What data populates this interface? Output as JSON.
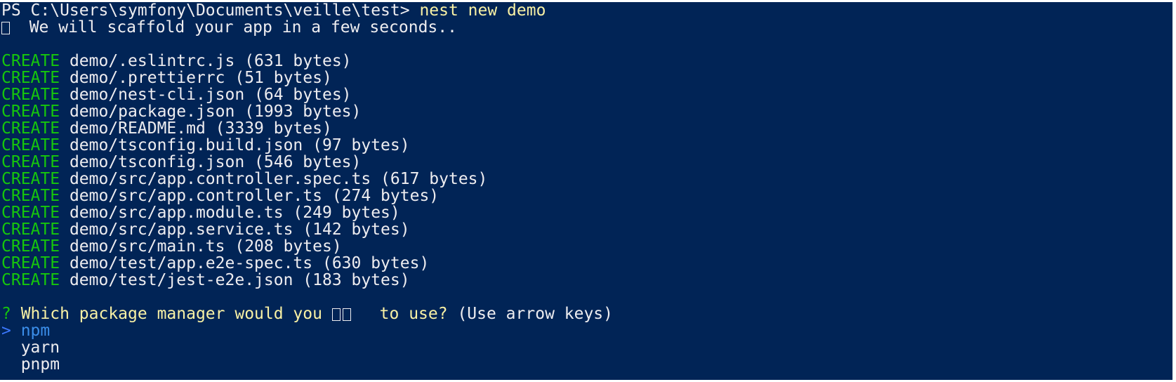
{
  "terminal": {
    "prompt": "PS C:\\Users\\symfony\\Documents\\veille\\test> ",
    "command": "nest new demo",
    "scaffold_message": "  We will scaffold your app in a few seconds..",
    "create_keyword": "CREATE",
    "files": [
      " demo/.eslintrc.js (631 bytes)",
      " demo/.prettierrc (51 bytes)",
      " demo/nest-cli.json (64 bytes)",
      " demo/package.json (1993 bytes)",
      " demo/README.md (3339 bytes)",
      " demo/tsconfig.build.json (97 bytes)",
      " demo/tsconfig.json (546 bytes)",
      " demo/src/app.controller.spec.ts (617 bytes)",
      " demo/src/app.controller.ts (274 bytes)",
      " demo/src/app.module.ts (249 bytes)",
      " demo/src/app.service.ts (142 bytes)",
      " demo/src/main.ts (208 bytes)",
      " demo/test/app.e2e-spec.ts (630 bytes)",
      " demo/test/jest-e2e.json (183 bytes)"
    ],
    "question_mark": "? ",
    "question_start": "Which package manager would you ",
    "question_end": " to use?",
    "question_hint": " (Use arrow keys)",
    "pointer": "> ",
    "options": [
      "npm",
      "yarn",
      "pnpm"
    ],
    "colors": {
      "background": "#012456",
      "text": "#eeedf0",
      "command": "#f9f1a5",
      "create": "#16c60c",
      "selected": "#3b8eea"
    },
    "icons": [
      "unknown-glyph-icon",
      "unknown-glyph-icon"
    ]
  }
}
